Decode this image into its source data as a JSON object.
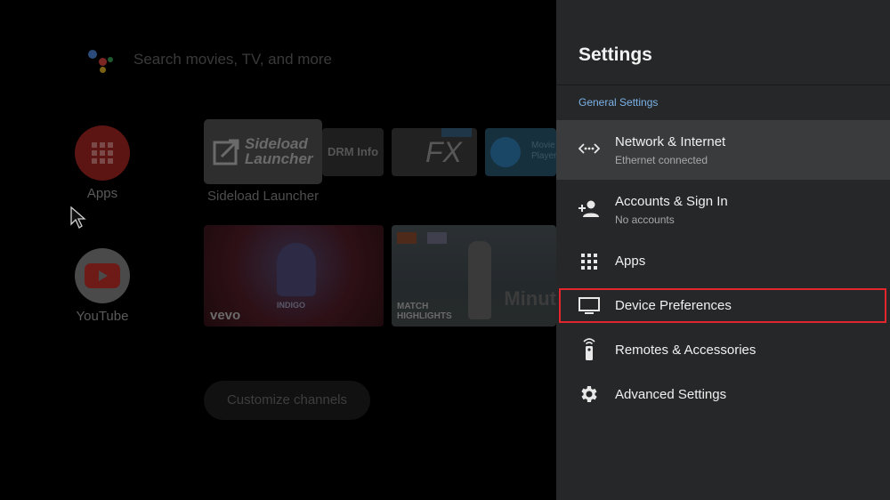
{
  "launcher": {
    "search_placeholder": "Search movies, TV, and more",
    "side_apps": [
      {
        "label": "Apps",
        "icon": "apps-grid-icon"
      },
      {
        "label": "YouTube",
        "icon": "youtube-icon"
      }
    ],
    "tiles": {
      "sideload_title_line1": "Sideload",
      "sideload_title_line2": "Launcher",
      "sideload_label": "Sideload Launcher",
      "drm": "DRM Info",
      "fx": "FX",
      "mx_line1": "Movie",
      "mx_line2": "Player",
      "vevo": "vevo",
      "vevo_caption": "INDIGO",
      "match_line1": "MATCH",
      "match_line2": "HIGHLIGHTS",
      "minute": "Minut"
    },
    "customize_label": "Customize channels"
  },
  "settings": {
    "title": "Settings",
    "section": "General Settings",
    "items": [
      {
        "title": "Network & Internet",
        "subtitle": "Ethernet connected",
        "icon": "network-icon"
      },
      {
        "title": "Accounts & Sign In",
        "subtitle": "No accounts",
        "icon": "add-account-icon"
      },
      {
        "title": "Apps",
        "subtitle": "",
        "icon": "apps-grid-icon"
      },
      {
        "title": "Device Preferences",
        "subtitle": "",
        "icon": "tv-icon"
      },
      {
        "title": "Remotes & Accessories",
        "subtitle": "",
        "icon": "remote-icon"
      },
      {
        "title": "Advanced Settings",
        "subtitle": "",
        "icon": "gear-icon"
      }
    ]
  },
  "colors": {
    "panel_bg": "#262728",
    "selected_bg": "#3a3b3c",
    "section_color": "#7bb2e8",
    "highlight_border": "#e3252d"
  }
}
